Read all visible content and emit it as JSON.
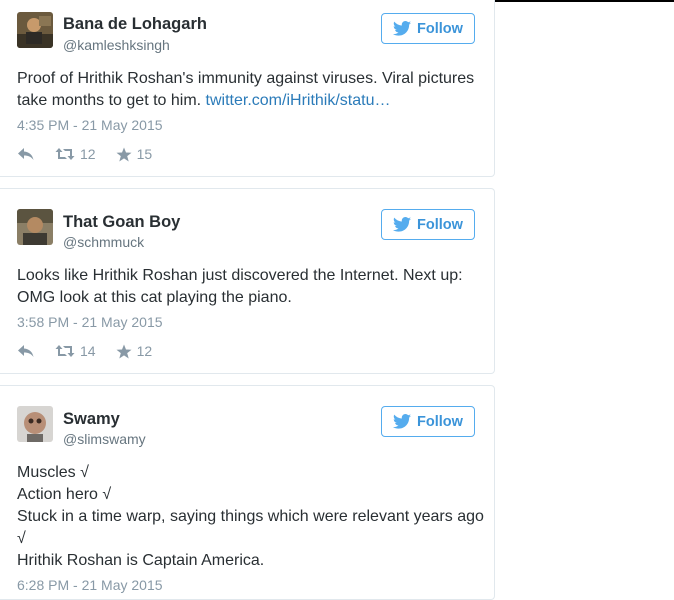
{
  "tweets": [
    {
      "name": "Bana de Lohagarh",
      "handle": "@kamleshksingh",
      "follow_label": "Follow",
      "text_lines": [
        "Proof of Hrithik Roshan's immunity against viruses. Viral pictures"
      ],
      "text_last": "take months to get to him. ",
      "link": "twitter.com/iHrithik/statu…",
      "time": "4:35 PM - 21 May 2015",
      "retweets": "12",
      "favorites": "15",
      "icons": {
        "reply": "reply-icon",
        "retweet": "retweet-icon",
        "favorite": "star-icon",
        "follow": "bird-icon"
      }
    },
    {
      "name": "That Goan Boy",
      "handle": "@schmmuck",
      "follow_label": "Follow",
      "text_lines": [
        "Looks like Hrithik Roshan just discovered the Internet. Next up:",
        "OMG look at this cat playing the piano."
      ],
      "time": "3:58 PM - 21 May 2015",
      "retweets": "14",
      "favorites": "12",
      "icons": {
        "reply": "reply-icon",
        "retweet": "retweet-icon",
        "favorite": "star-icon",
        "follow": "bird-icon"
      }
    },
    {
      "name": "Swamy",
      "handle": "@slimswamy",
      "follow_label": "Follow",
      "text_lines": [
        "Muscles √",
        "Action hero √",
        "Stuck in a time warp, saying things which were relevant years ago",
        "√",
        "Hrithik Roshan is Captain America."
      ],
      "time": "6:28 PM - 21 May 2015",
      "icons": {
        "follow": "bird-icon"
      }
    }
  ],
  "colors": {
    "accent": "#55acee",
    "link": "#2b7bb9",
    "text": "#292f33",
    "muted": "#8899a6"
  }
}
